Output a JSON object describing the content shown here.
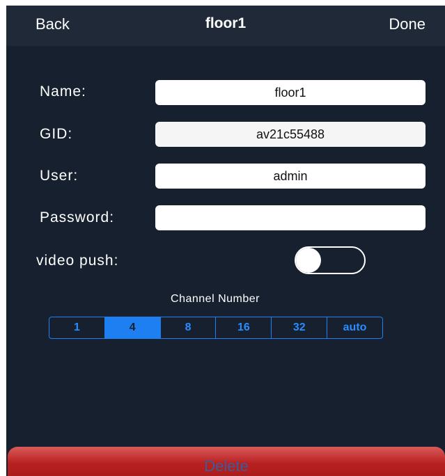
{
  "navbar": {
    "back_label": "Back",
    "title": "floor1",
    "done_label": "Done"
  },
  "form": {
    "name_label": "Name:",
    "name_value": "floor1",
    "gid_label": "GID:",
    "gid_value": "av21c55488",
    "user_label": "User:",
    "user_value": "admin",
    "password_label": "Password:",
    "password_value": ""
  },
  "video_push": {
    "label": "video push:",
    "enabled": false
  },
  "channel": {
    "heading": "Channel Number",
    "options": [
      "1",
      "4",
      "8",
      "16",
      "32",
      "auto"
    ],
    "selected": "4"
  },
  "delete_label": "Delete",
  "colors": {
    "background": "#16202e",
    "navbar": "#1f2937",
    "accent": "#1e7ff2",
    "delete": "#b82020"
  }
}
